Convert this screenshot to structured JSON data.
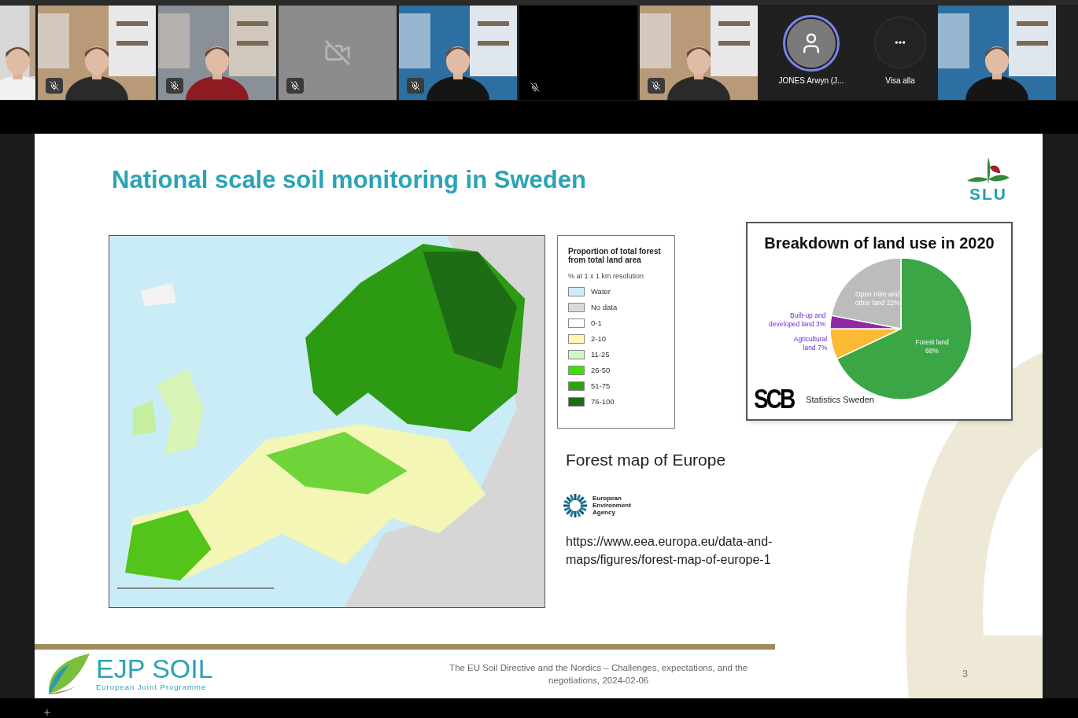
{
  "participants": [
    {
      "kind": "video",
      "muted": false
    },
    {
      "kind": "video",
      "muted": true
    },
    {
      "kind": "video",
      "muted": true
    },
    {
      "kind": "camera-off",
      "muted": true
    },
    {
      "kind": "video",
      "muted": true
    },
    {
      "kind": "no-video",
      "muted": true
    },
    {
      "kind": "video",
      "muted": true
    },
    {
      "kind": "avatar",
      "name": "JONES Arwyn (J...",
      "speaking": true
    },
    {
      "kind": "more",
      "label": "Visa alla"
    },
    {
      "kind": "video",
      "muted": false
    }
  ],
  "slide": {
    "title": "National scale soil monitoring in Sweden",
    "logo_text": "SLU",
    "map": {
      "kind": "picture"
    },
    "legend": {
      "title": "Proportion of total forest from total land area",
      "subtitle": "% at 1 x 1 km resolution",
      "items": [
        {
          "label": "Water",
          "color": "#cdeef8"
        },
        {
          "label": "No data",
          "color": "#d9d9d9"
        },
        {
          "label": "0-1",
          "color": "#ffffff"
        },
        {
          "label": "2-10",
          "color": "#fdfbb2"
        },
        {
          "label": "11-25",
          "color": "#d3f7c3"
        },
        {
          "label": "26-50",
          "color": "#43dc0e"
        },
        {
          "label": "51-75",
          "color": "#2ea10f"
        },
        {
          "label": "76-100",
          "color": "#1e6a16"
        }
      ]
    },
    "chart": {
      "title": "Breakdown of land use in 2020",
      "source_logo": "SCB",
      "source": "Statistics Sweden",
      "chart_data": {
        "type": "pie",
        "values": [
          68,
          7,
          3,
          22
        ],
        "colors": [
          "#3aa646",
          "#fbb934",
          "#8f2aa3",
          "#bdbcbc"
        ],
        "value_labels": [
          [
            "Forest land",
            "68%"
          ],
          [
            "Agricultural",
            "land 7%"
          ],
          [
            "Built-up and",
            "developed land 3%"
          ],
          [
            "Open mire and",
            "other land 22%"
          ]
        ]
      }
    },
    "caption": "Forest map of Europe",
    "agency": [
      "European",
      "Environment",
      "Agency"
    ],
    "url_lines": [
      "https://www.eea.europa.eu/data-and-",
      "maps/figures/forest-map-of-europe-1"
    ],
    "footer": {
      "brand": "EJP SOIL",
      "brand_sub": "European Joint Programme",
      "text": "The EU Soil Directive and the Nordics – Challenges, expectations, and the negotiations, 2024-02-06",
      "page": "3"
    }
  }
}
